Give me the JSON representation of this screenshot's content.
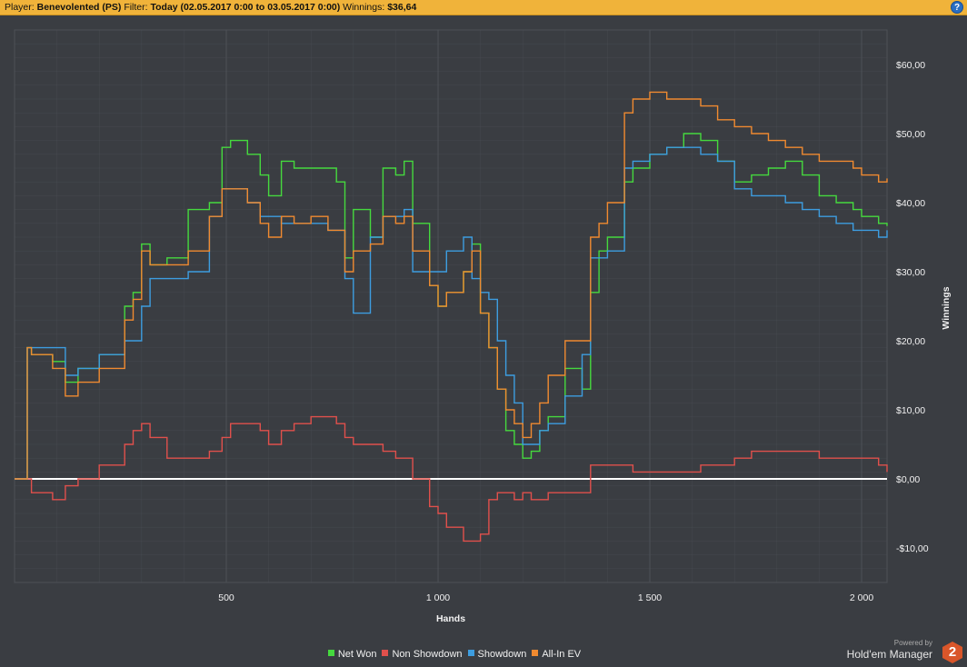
{
  "header": {
    "player_label": "Player:",
    "player_value": "Benevolented (PS)",
    "filter_label": "Filter:",
    "filter_value": "Today (02.05.2017 0:00 to 03.05.2017 0:00)",
    "winnings_label": "Winnings:",
    "winnings_value": "$36,64",
    "help_icon": "help-icon"
  },
  "branding": {
    "powered_by": "Powered by",
    "product": "Hold'em Manager",
    "badge": "2"
  },
  "colors": {
    "background": "#3a3d42",
    "grid": "#4d5157",
    "zero_line": "#ffffff",
    "net_won": "#45d93e",
    "non_showdown": "#e0504c",
    "showdown": "#3d9de0",
    "all_in_ev": "#f08a30"
  },
  "chart_data": {
    "type": "line",
    "title": "",
    "xlabel": "Hands",
    "ylabel": "Winnings",
    "xlim": [
      0,
      2060
    ],
    "ylim": [
      -15,
      65
    ],
    "x_ticks": [
      500,
      1000,
      1500,
      2000
    ],
    "x_tick_labels": [
      "500",
      "1 000",
      "1 500",
      "2 000"
    ],
    "y_ticks": [
      -10,
      0,
      10,
      20,
      30,
      40,
      50,
      60
    ],
    "y_tick_labels": [
      "-$10,00",
      "$0,00",
      "$10,00",
      "$20,00",
      "$30,00",
      "$40,00",
      "$50,00",
      "$60,00"
    ],
    "grid": true,
    "legend_position": "bottom",
    "x": [
      0,
      30,
      40,
      90,
      120,
      150,
      200,
      260,
      280,
      300,
      320,
      360,
      410,
      460,
      490,
      510,
      550,
      580,
      600,
      630,
      660,
      700,
      740,
      760,
      780,
      800,
      840,
      870,
      900,
      920,
      940,
      980,
      1000,
      1020,
      1060,
      1080,
      1100,
      1120,
      1140,
      1160,
      1180,
      1200,
      1220,
      1240,
      1260,
      1300,
      1340,
      1360,
      1380,
      1400,
      1440,
      1460,
      1500,
      1540,
      1580,
      1620,
      1660,
      1700,
      1740,
      1780,
      1820,
      1860,
      1900,
      1940,
      1980,
      2000,
      2040,
      2060
    ],
    "series": [
      {
        "name": "Net Won",
        "color": "#45d93e",
        "values": [
          0,
          19,
          18,
          17,
          14,
          16,
          18,
          25,
          27,
          34,
          31,
          32,
          39,
          40,
          48,
          49,
          47,
          44,
          41,
          46,
          45,
          45,
          45,
          43,
          32,
          39,
          35,
          45,
          44,
          46,
          37,
          28,
          25,
          27,
          30,
          34,
          24,
          19,
          13,
          7,
          5,
          3,
          4,
          7,
          9,
          16,
          13,
          27,
          33,
          35,
          43,
          45,
          47,
          48,
          50,
          49,
          46,
          43,
          44,
          45,
          46,
          44,
          41,
          40,
          39,
          38,
          37,
          36.6
        ]
      },
      {
        "name": "Non Showdown",
        "color": "#e0504c",
        "values": [
          0,
          0,
          -2,
          -3,
          -1,
          0,
          2,
          5,
          7,
          8,
          6,
          3,
          3,
          4,
          6,
          8,
          8,
          7,
          5,
          7,
          8,
          9,
          9,
          8,
          6,
          5,
          5,
          4,
          3,
          3,
          0,
          -4,
          -5,
          -7,
          -9,
          -9,
          -8,
          -3,
          -2,
          -2,
          -3,
          -2,
          -3,
          -3,
          -2,
          -2,
          -2,
          2,
          2,
          2,
          2,
          1,
          1,
          1,
          1,
          2,
          2,
          3,
          4,
          4,
          4,
          4,
          3,
          3,
          3,
          3,
          2,
          1
        ]
      },
      {
        "name": "Showdown",
        "color": "#3d9de0",
        "values": [
          0,
          19,
          19,
          19,
          15,
          16,
          18,
          20,
          20,
          25,
          29,
          29,
          30,
          38,
          42,
          42,
          40,
          38,
          38,
          37,
          37,
          37,
          36,
          36,
          29,
          24,
          35,
          38,
          38,
          39,
          30,
          30,
          30,
          33,
          35,
          29,
          27,
          26,
          20,
          15,
          11,
          5,
          5,
          7,
          8,
          12,
          18,
          32,
          32,
          33,
          45,
          46,
          47,
          48,
          48,
          47,
          46,
          42,
          41,
          41,
          40,
          39,
          38,
          37,
          36,
          36,
          35,
          36
        ]
      },
      {
        "name": "All-In EV",
        "color": "#f08a30",
        "values": [
          0,
          19,
          18,
          16,
          12,
          14,
          16,
          23,
          26,
          33,
          31,
          31,
          33,
          38,
          42,
          42,
          40,
          37,
          35,
          38,
          37,
          38,
          36,
          36,
          30,
          33,
          34,
          38,
          37,
          38,
          33,
          28,
          25,
          27,
          30,
          33,
          24,
          19,
          13,
          10,
          8,
          6,
          8,
          11,
          15,
          20,
          20,
          35,
          37,
          40,
          53,
          55,
          56,
          55,
          55,
          54,
          52,
          51,
          50,
          49,
          48,
          47,
          46,
          46,
          45,
          44,
          43,
          43.5
        ]
      }
    ]
  }
}
